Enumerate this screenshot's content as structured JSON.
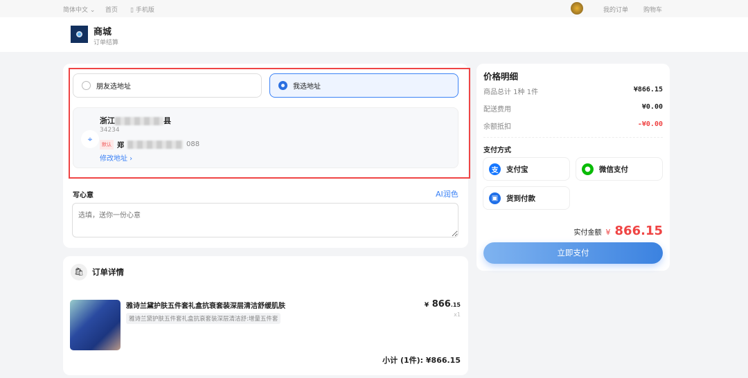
{
  "topbar": {
    "language": "简体中文",
    "home": "首页",
    "mobile": "手机版",
    "my_orders": "我的订单",
    "cart": "购物车"
  },
  "header": {
    "title": "商城",
    "subtitle": "订单结算"
  },
  "address": {
    "options": [
      "朋友选地址",
      "我选地址"
    ],
    "selected": 1,
    "region": "浙江",
    "region_end": "县",
    "postcode": "34234",
    "default_tag": "默认",
    "name": "郑",
    "phone_end": "088",
    "edit_link": "修改地址"
  },
  "note": {
    "label": "写心意",
    "ai_button": "AI润色",
    "placeholder": "选填，送你一份心意"
  },
  "order": {
    "title": "订单详情",
    "item": {
      "name": "雅诗兰黛护肤五件套礼盒抗衰套装深层清洁舒缓肌肤",
      "spec": "雅诗兰黛护肤五件套礼盒抗衰套装深层清洁舒:增量五件套",
      "price_symbol": "¥",
      "price_int": "866",
      "price_dec": ".15",
      "qty": "x1"
    },
    "subtotal": "小计 (1件): ¥866.15"
  },
  "price": {
    "title": "价格明细",
    "rows": [
      {
        "label": "商品总计 1种 1件",
        "value": "¥866.15"
      },
      {
        "label": "配送费用",
        "value": "¥0.00"
      },
      {
        "label": "余额抵扣",
        "value": "-¥0.00"
      }
    ],
    "pay_title": "支付方式",
    "methods": [
      "支付宝",
      "微信支付",
      "货到付款"
    ],
    "total_label": "实付金额",
    "total_symbol": "¥",
    "total": "866.15",
    "submit": "立即支付"
  },
  "colors": {
    "accent": "#3b82f6",
    "danger": "#ef4444",
    "highlight_box": "#ef4444"
  }
}
